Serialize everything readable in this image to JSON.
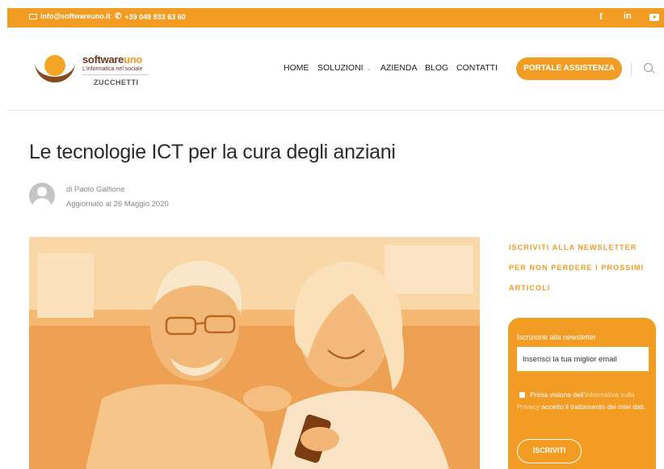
{
  "topbar": {
    "email": "info@softwareuno.it",
    "phone": "+39 049 933 63 60",
    "social": {
      "facebook": "f",
      "linkedin": "in"
    }
  },
  "logo": {
    "brand_part1": "software",
    "brand_part2": "uno",
    "tagline": "L'informatica nel sociale",
    "company": "ZUCCHETTI"
  },
  "nav": {
    "items": [
      "HOME",
      "SOLUZIONI",
      "AZIENDA",
      "BLOG",
      "CONTATTI"
    ],
    "cta": "PORTALE ASSISTENZA"
  },
  "post": {
    "title": "Le tecnologie ICT per la cura degli anziani",
    "author": "di Paolo Galfione",
    "updated": "Aggiornato al 26 Maggio 2020"
  },
  "sidebar": {
    "heading": "ISCRIVITI ALLA NEWSLETTER PER NON PERDERE I PROSSIMI ARTICOLI",
    "form_label": "Iscrizione alla newsletter",
    "input_placeholder": "Inserisci la tua miglior email",
    "privacy_prefix": "Presa visione dell'",
    "privacy_link": "informativa sulla Privacy",
    "privacy_suffix": " accetto il trattamento dei miei dati.",
    "button_label": "ISCRIVITI"
  },
  "colors": {
    "accent": "#f39c24",
    "brown": "#6b3a1f"
  }
}
